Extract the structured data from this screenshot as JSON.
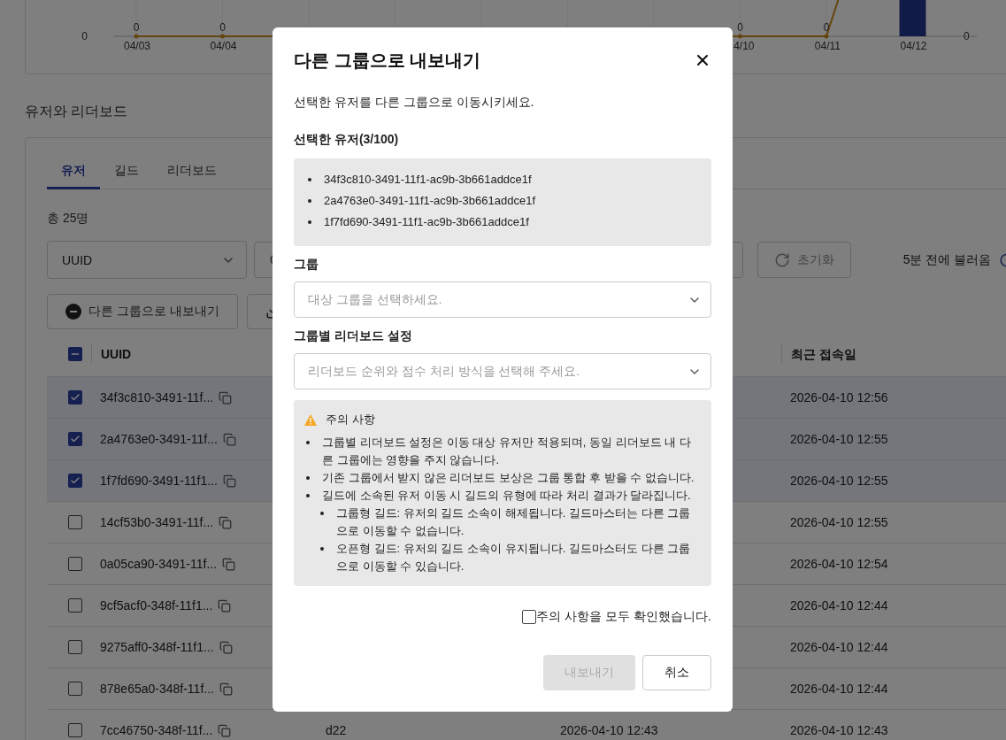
{
  "chart": {
    "axis_labels": [
      "0",
      "0"
    ],
    "left_points": [
      {
        "label": "04/03",
        "value_label": "0",
        "peak": false
      },
      {
        "label": "04/04",
        "value_label": "0",
        "peak": false
      }
    ],
    "right_points": [
      {
        "label": "4/10",
        "value_label": "0",
        "peak": false
      },
      {
        "label": "04/11",
        "value_label": "0",
        "peak": false
      },
      {
        "label": "04/12",
        "peak": true
      }
    ]
  },
  "section_title": "유저와 리더보드",
  "tabs": [
    {
      "label": "유저",
      "selected": true
    },
    {
      "label": "길드",
      "selected": false
    },
    {
      "label": "리더보드",
      "selected": false
    }
  ],
  "total": "총 25명",
  "filter": {
    "field": "UUID",
    "reset_button": "초기화",
    "fetched": "5분 전에 불러옴"
  },
  "actions": {
    "export_button": "다른 그룹으로 내보내기"
  },
  "table": {
    "indeterminate": true,
    "columns": [
      "UUID",
      "최근 접속일"
    ],
    "rows": [
      {
        "selected": true,
        "uuid": "34f3c810-3491-11f...",
        "last_access": "2026-04-10 12:56"
      },
      {
        "selected": true,
        "uuid": "2a4763e0-3491-11f...",
        "last_access": "2026-04-10 12:55"
      },
      {
        "selected": true,
        "uuid": "1f7fd690-3491-11f1...",
        "last_access": "2026-04-10 12:55"
      },
      {
        "selected": false,
        "uuid": "14cf53b0-3491-11f...",
        "last_access": "2026-04-10 12:55"
      },
      {
        "selected": false,
        "uuid": "0a05ca90-3491-11f...",
        "last_access": "2026-04-10 12:54"
      },
      {
        "selected": false,
        "uuid": "9cf5acf0-348f-11f1...",
        "last_access": "2026-04-10 12:44"
      },
      {
        "selected": false,
        "uuid": "9275aff0-348f-11f1...",
        "last_access": "2026-04-10 12:44"
      },
      {
        "selected": false,
        "uuid": "878e65a0-348f-11f...",
        "last_access": "2026-04-10 12:44"
      },
      {
        "selected": false,
        "uuid": "7cc46750-348f-11f...",
        "column_3": "d22",
        "column_4": "2026-04-10 12:43",
        "last_access": "2026-04-10 12:43"
      }
    ]
  },
  "modal": {
    "title": "다른 그룹으로 내보내기",
    "description": "선택한 유저를 다른 그룹으로 이동시키세요.",
    "selected_label": "선택한 유저(3/100)",
    "selected_uuids": [
      "34f3c810-3491-11f1-ac9b-3b661addce1f",
      "2a4763e0-3491-11f1-ac9b-3b661addce1f",
      "1f7fd690-3491-11f1-ac9b-3b661addce1f"
    ],
    "group": {
      "label": "그룹",
      "placeholder": "대상 그룹을 선택하세요."
    },
    "leaderboard": {
      "label": "그룹별 리더보드 설정",
      "placeholder": "리더보드 순위와 점수 처리 방식을 선택해 주세요."
    },
    "notice": {
      "title": "주의 사항",
      "items": [
        {
          "text": "그룹별 리더보드 설정은 이동 대상 유저만 적용되며, 동일 리더보드 내 다른 그룹에는 영향을 주지 않습니다."
        },
        {
          "text": "기존 그룹에서 받지 않은 리더보드 보상은 그룹 통합 후 받을 수 없습니다."
        },
        {
          "text": "길드에 소속된 유저 이동 시 길드의 유형에 따라 처리 결과가 달라집니다.",
          "children": [
            {
              "text": "그룹형 길드: 유저의 길드 소속이 해제됩니다. 길드마스터는 다른 그룹으로 이동할 수 없습니다."
            },
            {
              "text": "오픈형 길드: 유저의 길드 소속이 유지됩니다. 길드마스터도 다른 그룹으로 이동할 수 있습니다."
            }
          ]
        }
      ]
    },
    "confirm": {
      "label": "주의 사항을 모두 확인했습니다.",
      "checked": false
    },
    "buttons": [
      {
        "kind": "primary",
        "label": "내보내기",
        "disabled": true
      },
      {
        "kind": "secondary",
        "label": "취소"
      }
    ]
  }
}
